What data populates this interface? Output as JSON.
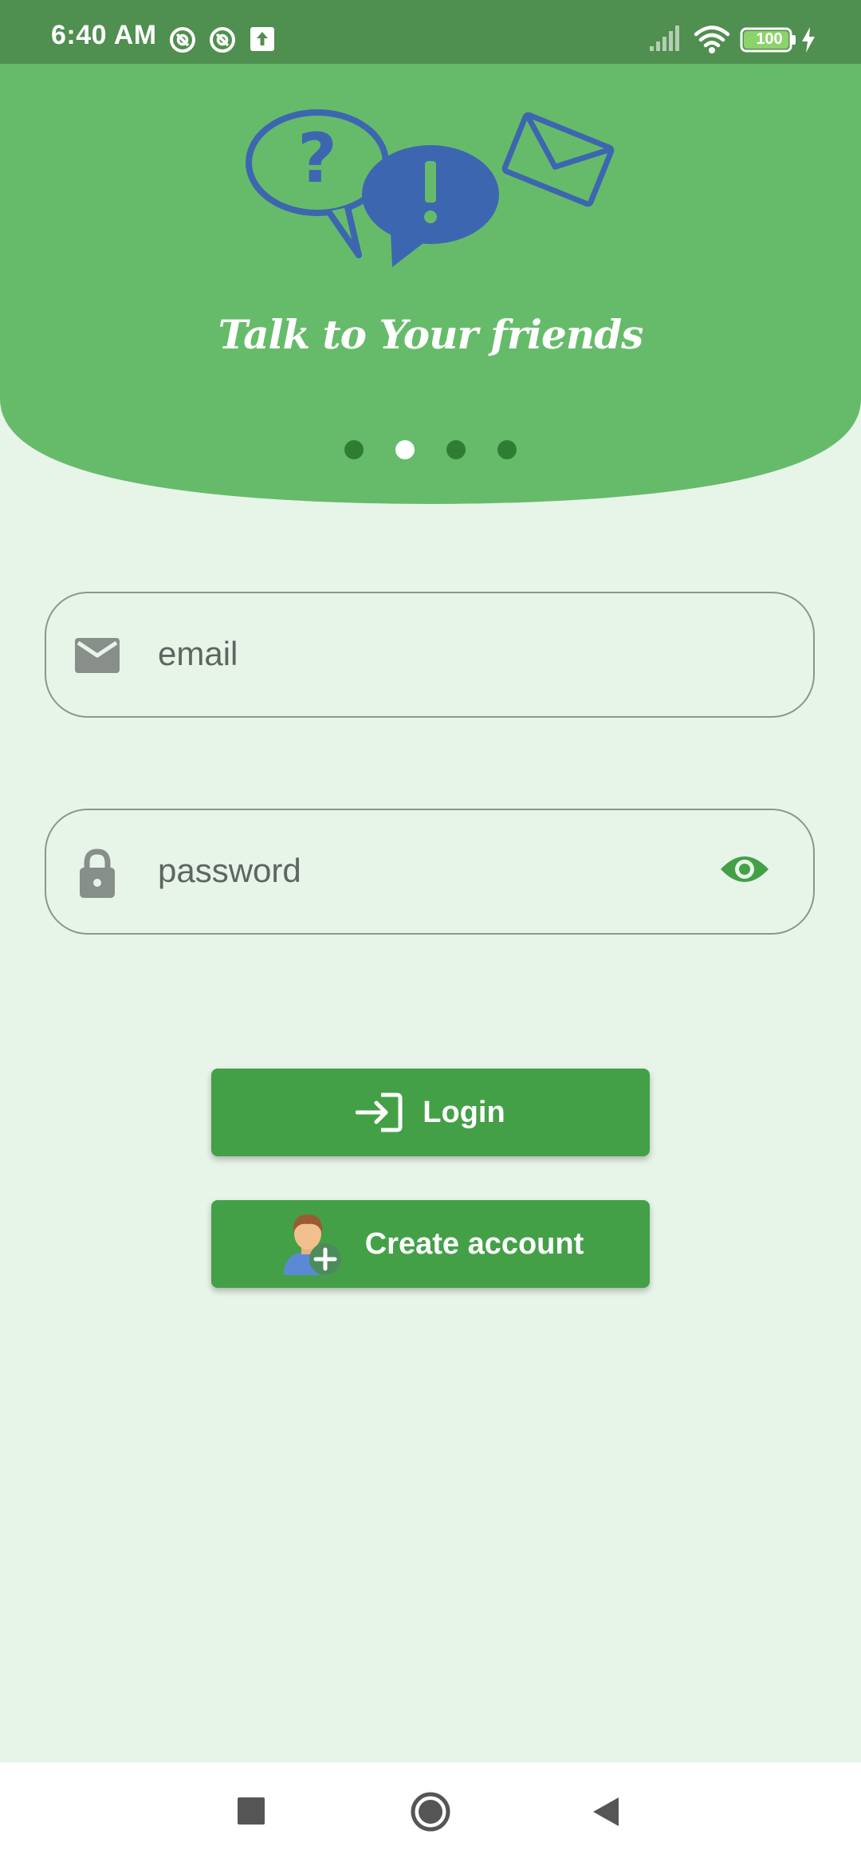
{
  "status_bar": {
    "time": "6:40 AM",
    "battery_level": "100",
    "icons": [
      "at-sign-icon",
      "at-sign-icon",
      "upload-icon",
      "signal-icon",
      "wifi-icon",
      "battery-icon",
      "charging-bolt-icon"
    ]
  },
  "hero": {
    "title": "Talk to Your friends",
    "icons": [
      "question-bubble-icon",
      "exclamation-bubble-icon",
      "envelope-icon"
    ],
    "page_indicator": {
      "count": 4,
      "active_index": 1
    }
  },
  "form": {
    "email": {
      "placeholder": "email",
      "value": "",
      "icon": "mail-icon"
    },
    "password": {
      "placeholder": "password",
      "value": "",
      "icon": "lock-icon",
      "toggle_icon": "eye-icon"
    }
  },
  "actions": {
    "login_label": "Login",
    "login_icon": "login-icon",
    "create_label": "Create account",
    "create_icon": "add-user-icon"
  },
  "navigation": {
    "buttons": [
      "recents-square-icon",
      "home-circle-icon",
      "back-triangle-icon"
    ]
  },
  "colors": {
    "status_bar": "#4f8f4f",
    "header": "#66bb6a",
    "background": "#e7f4e8",
    "button": "#43a047",
    "hero_icon": "#3d66b0",
    "dot": "#2e7d32",
    "eye": "#43a047"
  }
}
